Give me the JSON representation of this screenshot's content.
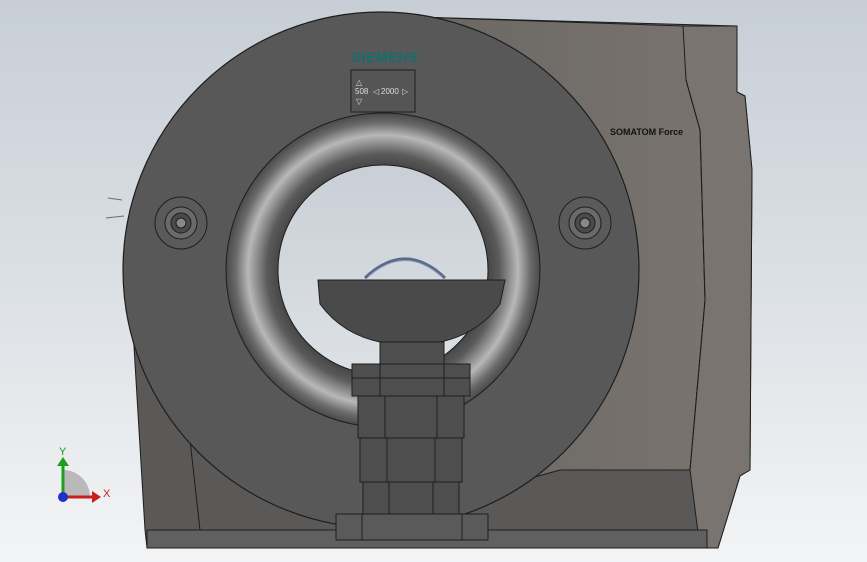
{
  "brand": {
    "text": "SIEMENS",
    "color": "#0f6f73"
  },
  "control_panel": {
    "left_value": "508",
    "right_value": "2000"
  },
  "model_label": "SOMATOM Force",
  "triad": {
    "y_label": "Y",
    "x_label": "X",
    "y_color": "#1aa01a",
    "x_color": "#c81e1e",
    "z_color": "#2030c8"
  },
  "icons": [
    "up-triangle-icon",
    "down-triangle-icon",
    "left-triangle-icon",
    "right-triangle-icon"
  ],
  "colors": {
    "housing": "#585858",
    "housing_side": "#6e6a66",
    "bore_interior": "#c8ccd2",
    "table": "#4a4a4a",
    "outline": "#1e1e1e"
  }
}
